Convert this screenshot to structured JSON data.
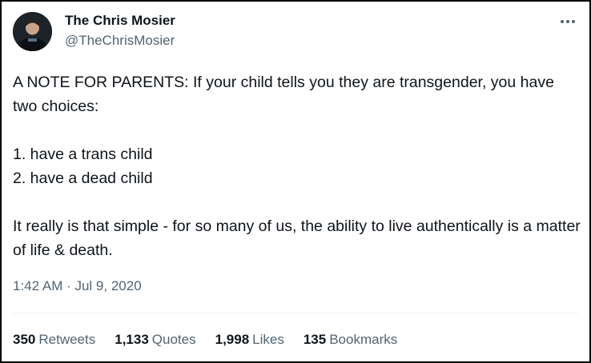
{
  "author": {
    "name": "The Chris Mosier",
    "handle": "@TheChrisMosier",
    "avatar_icon": "profile-photo"
  },
  "more_icon": "more-dots-icon",
  "tweet": {
    "paragraphs": [
      "A NOTE FOR PARENTS: If your child tells you they are transgender, you have two choices:",
      "1. have a trans child",
      "2. have a dead child",
      "It really is that simple - for so many of us, the ability to live authentically is a matter of life & death."
    ],
    "timestamp": "1:42 AM · Jul 9, 2020"
  },
  "stats": {
    "retweets": {
      "count": "350",
      "label": "Retweets"
    },
    "quotes": {
      "count": "1,133",
      "label": "Quotes"
    },
    "likes": {
      "count": "1,998",
      "label": "Likes"
    },
    "bookmarks": {
      "count": "135",
      "label": "Bookmarks"
    }
  },
  "colors": {
    "text_primary": "#0f1419",
    "text_secondary": "#536471",
    "divider": "#eff3f4",
    "border": "#000000"
  }
}
